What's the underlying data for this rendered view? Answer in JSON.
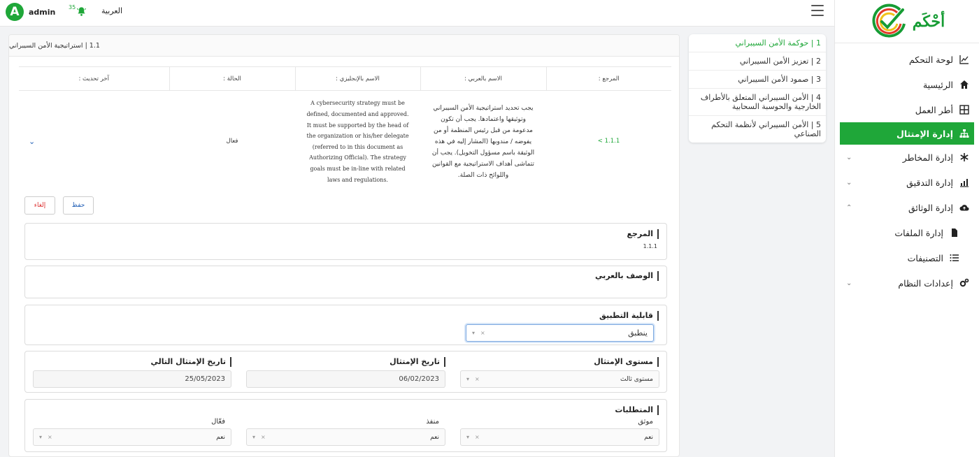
{
  "topbar": {
    "avatar_letter": "A",
    "username": "admin",
    "notification_count": "35",
    "language_label": "العربية"
  },
  "sidebar": {
    "brand": "أحْكَم",
    "items": [
      {
        "label": "لوحة التحكم"
      },
      {
        "label": "الرئيسية"
      },
      {
        "label": "أطر العمل"
      },
      {
        "label": "إدارة الإمتثال"
      },
      {
        "label": "إدارة المخاطر"
      },
      {
        "label": "إدارة التدقيق"
      },
      {
        "label": "إدارة الوثائق"
      },
      {
        "label": "إدارة الملفات"
      },
      {
        "label": "التصنيفات"
      },
      {
        "label": "إعدادات النظام"
      }
    ]
  },
  "sections": [
    {
      "label": "1 | حوكمة الأمن السيبراني"
    },
    {
      "label": "2 | تعزيز الأمن السيبراني"
    },
    {
      "label": "3 | صمود الأمن السيبراني"
    },
    {
      "label": "4 | الأمن السيبراني المتعلق بالأطراف الخارجية والحوسبة السحابية"
    },
    {
      "label": "5 | الأمن السيبراني لأنظمة التحكم الصناعي"
    }
  ],
  "card": {
    "breadcrumb": "1.1 | استراتيجية الأمن السيبراني",
    "table": {
      "headers": {
        "ref": "المرجع :",
        "name_ar": "الاسم بالعربي :",
        "name_en": "الاسم بالإنجليزي :",
        "status": "الحالة :",
        "last_update": "آخر تحديث :"
      },
      "row": {
        "ref": "1.1.1 >",
        "name_ar": "يجب تحديد استراتيجية الأمن السيبراني وتوثيقها واعتمادها. يجب أن تكون مدعومة من قبل رئيس المنظمة أو من يفوضه / مندوبها (المشار إليه في هذه الوثيقة باسم مسؤول التخويل). يجب أن تتماشى أهداف الاستراتيجية مع القوانين واللوائح ذات الصلة.",
        "name_en": "A cybersecurity strategy must be defined, documented and approved. It must be supported by the head of the organization or his/her delegate (referred to in this document as Authorizing Official). The strategy goals must be in-line with related laws and regulations.",
        "status": "فعال",
        "last_update": ""
      }
    },
    "buttons": {
      "save": "حفظ",
      "cancel": "إلغاء"
    },
    "reference": {
      "label": "المرجع",
      "value": "1.1.1"
    },
    "arabic_description": {
      "label": "الوصف بالعربي"
    },
    "applicability": {
      "label": "قابلية التطبيق",
      "value": "ينطبق"
    },
    "compliance": {
      "level_label": "مستوى الإمتثال",
      "level_value": "مستوى ثالث",
      "date_label": "تاريخ الإمتثال",
      "date_value": "06/02/2023",
      "next_date_label": "تاريخ الإمتثال التالي",
      "next_date_value": "25/05/2023"
    },
    "requirements": {
      "label": "المتطلبات",
      "documented_label": "موثق",
      "documented_value": "نعم",
      "implemented_label": "منفذ",
      "implemented_value": "نعم",
      "effective_label": "فعّال",
      "effective_value": "نعم"
    }
  },
  "colors": {
    "brand_green": "#1fa739",
    "link_blue": "#1f5eb5",
    "danger_red": "#d33333"
  }
}
